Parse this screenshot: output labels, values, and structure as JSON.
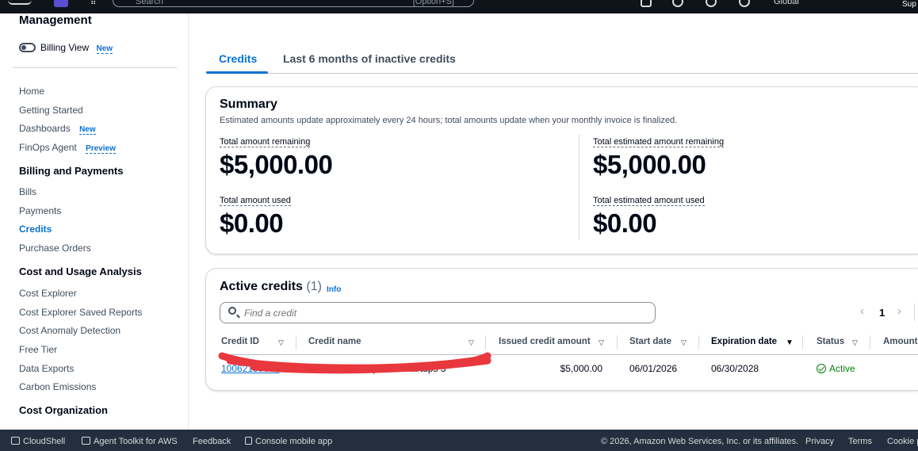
{
  "topbar": {
    "search_placeholder": "Search",
    "search_shortcut": "[Option+S]",
    "region": "Global",
    "support": "Sup"
  },
  "sidebar": {
    "title": "Management",
    "billing_view": "Billing View",
    "new_badge": "New",
    "preview_badge": "Preview",
    "items": {
      "home": "Home",
      "getting_started": "Getting Started",
      "dashboards": "Dashboards",
      "finops_agent": "FinOps Agent",
      "billing_payments": "Billing and Payments",
      "bills": "Bills",
      "payments": "Payments",
      "credits": "Credits",
      "purchase_orders": "Purchase Orders",
      "cost_usage": "Cost and Usage Analysis",
      "cost_explorer": "Cost Explorer",
      "cost_explorer_saved": "Cost Explorer Saved Reports",
      "cost_anomaly": "Cost Anomaly Detection",
      "free_tier": "Free Tier",
      "data_exports": "Data Exports",
      "carbon": "Carbon Emissions",
      "cost_org": "Cost Organization"
    }
  },
  "tabs": [
    "Credits",
    "Last 6 months of inactive credits"
  ],
  "summary": {
    "title": "Summary",
    "description": "Estimated amounts update approximately every 24 hours; total amounts update when your monthly invoice is finalized.",
    "remaining_label": "Total amount remaining",
    "remaining_value": "$5,000.00",
    "used_label": "Total amount used",
    "used_value": "$0.00",
    "est_remaining_label": "Total estimated amount remaining",
    "est_remaining_value": "$5,000.00",
    "est_used_label": "Total estimated amount used",
    "est_used_value": "$0.00"
  },
  "credits": {
    "title": "Active credits",
    "count": "(1)",
    "info": "Info",
    "search_placeholder": "Find a credit",
    "page": "1",
    "columns": [
      "Credit ID",
      "Credit name",
      "Issued credit amount",
      "Start date",
      "Expiration date",
      "Status",
      "Amount"
    ],
    "rows": [
      {
        "credit_id": "10062159852",
        "credit_name": "Activate - Hubspot for Startups 3",
        "issued_amount": "$5,000.00",
        "start_date": "06/01/2026",
        "expiration_date": "06/30/2028",
        "status": "Active"
      }
    ]
  },
  "footer": {
    "cloudshell": "CloudShell",
    "agent_toolkit": "Agent Toolkit for AWS",
    "feedback": "Feedback",
    "console_mobile": "Console mobile app",
    "copyright": "© 2026, Amazon Web Services, Inc. or its affiliates.",
    "privacy": "Privacy",
    "terms": "Terms",
    "cookie": "Cookie p"
  },
  "colors": {
    "accent": "#0972d3",
    "success": "#037f0c",
    "redaction": "#e8383d",
    "nav_dark": "#232f3e"
  }
}
